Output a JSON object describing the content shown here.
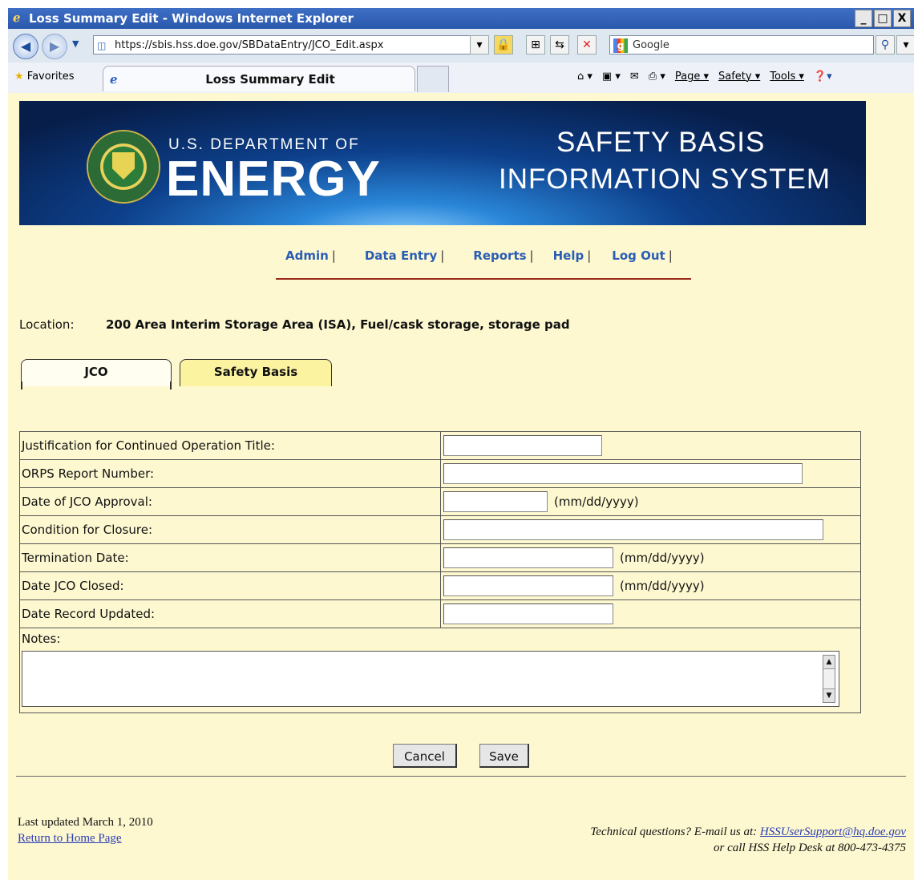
{
  "window": {
    "title": "Loss Summary Edit - Windows Internet Explorer",
    "buttons": [
      "_",
      "□",
      "X"
    ]
  },
  "address_bar": {
    "url": "https://sbis.hss.doe.gov/SBDataEntry/JCO_Edit.aspx",
    "search_placeholder": "Google"
  },
  "favorites_bar": {
    "favorites_label": "Favorites",
    "tab_title": "Loss Summary Edit",
    "commands": [
      "Page ▾",
      "Safety ▾",
      "Tools ▾"
    ]
  },
  "banner": {
    "agency_line1": "U.S. DEPARTMENT OF",
    "agency_line2": "ENERGY",
    "system_line1": "SAFETY BASIS",
    "system_line2": "INFORMATION SYSTEM"
  },
  "nav": {
    "admin": "Admin",
    "data_entry": "Data Entry",
    "reports": "Reports",
    "help": "Help",
    "logout": "Log Out",
    "separator": "|"
  },
  "location": {
    "label": "Location:",
    "value": "200 Area Interim Storage Area (ISA), Fuel/cask storage, storage pad"
  },
  "tabs": {
    "jco": "JCO",
    "safety_basis": "Safety Basis"
  },
  "form": {
    "jco_title_label": "Justification for Continued Operation Title:",
    "orps_label": "ORPS Report Number:",
    "approval_label": "Date of JCO Approval:",
    "closure_label": "Condition for Closure:",
    "termination_label": "Termination Date:",
    "closed_label": "Date JCO Closed:",
    "updated_label": "Date Record Updated:",
    "notes_label": "Notes:",
    "date_hint": "(mm/dd/yyyy)"
  },
  "buttons": {
    "cancel": "Cancel",
    "save": "Save"
  },
  "footer": {
    "last_updated": "Last updated March 1, 2010",
    "home_link": "Return to Home Page",
    "tech_prefix": "Technical questions? E-mail us at:",
    "email": "HSSUserSupport@hq.doe.gov",
    "help_desk": "or call HSS Help Desk at 800-473-4375"
  }
}
